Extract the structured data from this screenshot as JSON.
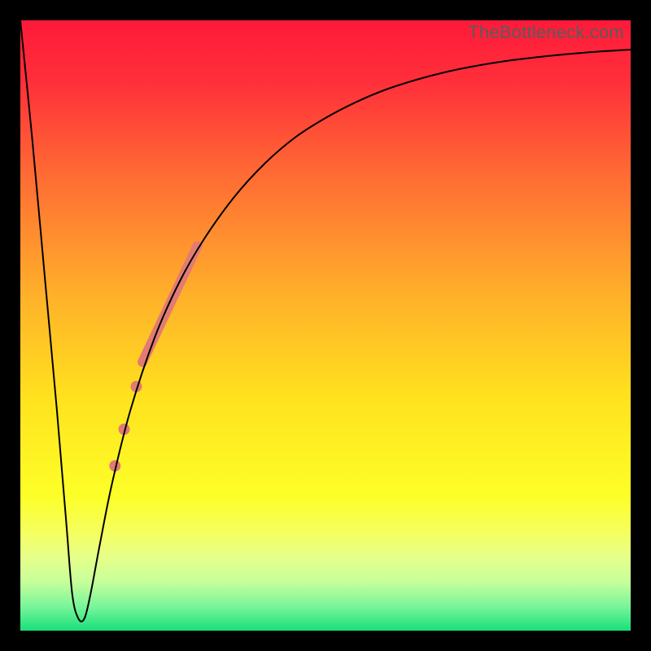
{
  "watermark": "TheBottleneck.com",
  "chart_data": {
    "type": "line",
    "title": "",
    "xlabel": "",
    "ylabel": "",
    "xlim": [
      0,
      100
    ],
    "ylim": [
      0,
      100
    ],
    "grid": false,
    "legend": false,
    "background": {
      "type": "vertical-gradient",
      "stops": [
        {
          "pos": 0.0,
          "color": "#ff1a3a"
        },
        {
          "pos": 0.1,
          "color": "#ff2f3a"
        },
        {
          "pos": 0.25,
          "color": "#ff6a34"
        },
        {
          "pos": 0.45,
          "color": "#ffb02a"
        },
        {
          "pos": 0.62,
          "color": "#ffe21e"
        },
        {
          "pos": 0.78,
          "color": "#fdff28"
        },
        {
          "pos": 0.84,
          "color": "#f4ff60"
        },
        {
          "pos": 0.88,
          "color": "#e6ff8a"
        },
        {
          "pos": 0.92,
          "color": "#c6ff9a"
        },
        {
          "pos": 0.96,
          "color": "#7af59a"
        },
        {
          "pos": 1.0,
          "color": "#18e07a"
        }
      ]
    },
    "series": [
      {
        "name": "bottleneck-curve",
        "color": "#000000",
        "width": 2,
        "x": [
          0,
          2,
          4,
          6,
          7.5,
          8.5,
          9.5,
          10.5,
          11.5,
          13,
          15,
          18,
          22,
          26,
          30,
          35,
          40,
          45,
          50,
          55,
          60,
          65,
          70,
          75,
          80,
          85,
          90,
          95,
          100
        ],
        "y": [
          100,
          80,
          58,
          36,
          18,
          6,
          2,
          2,
          6,
          14,
          24,
          36,
          48,
          57,
          64,
          71,
          76.5,
          80.8,
          84.0,
          86.6,
          88.7,
          90.3,
          91.6,
          92.6,
          93.4,
          94.0,
          94.5,
          94.9,
          95.2
        ]
      }
    ],
    "markers": {
      "name": "highlight-segment",
      "color": "#e27b72",
      "segment": {
        "x1": 20,
        "y1": 44,
        "x2": 29,
        "y2": 63,
        "width": 12
      },
      "dots": [
        {
          "x": 19.0,
          "y": 40.0,
          "r": 7
        },
        {
          "x": 17.0,
          "y": 33.0,
          "r": 7
        },
        {
          "x": 15.5,
          "y": 27.0,
          "r": 7
        }
      ]
    }
  }
}
